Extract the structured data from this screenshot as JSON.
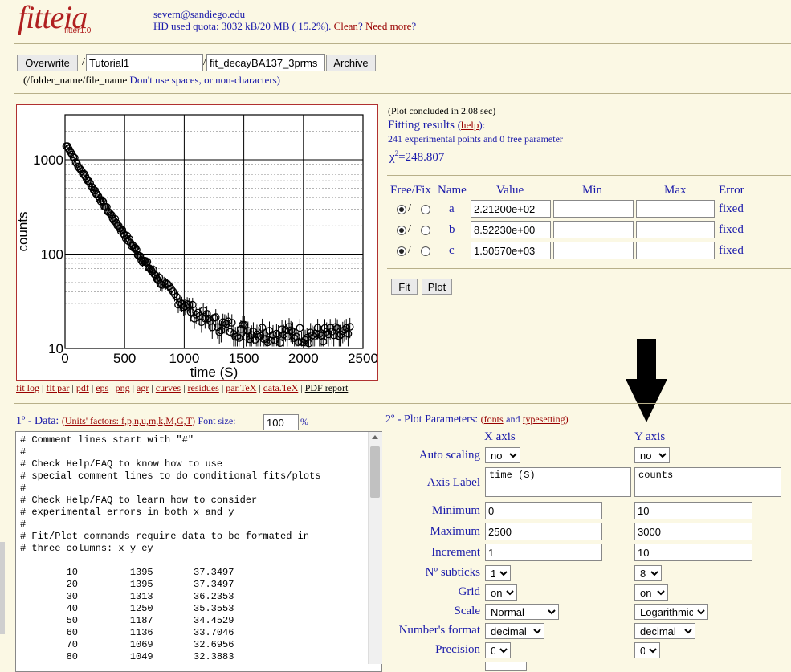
{
  "header": {
    "logo": "fitteia",
    "logo_sub": "fitter1.0",
    "email": "severn@sandiego.edu",
    "quota": "HD used quota: 3032 kB/20 MB ( 15.2%).",
    "clean": "Clean",
    "question": "?",
    "need_more": "Need more",
    "question2": "?"
  },
  "file": {
    "overwrite": "Overwrite",
    "slash1": "/",
    "folder": "Tutorial1",
    "slash2": "/",
    "filename": "fit_decayBA137_3prms",
    "archive": "Archive",
    "hint_path": "(/folder_name/file_name",
    "hint_text": "Don't use spaces, or non-characters)"
  },
  "plot": {
    "chart_data": {
      "type": "scatter",
      "xlabel": "time (S)",
      "ylabel": "counts",
      "xlim": [
        0,
        2500
      ],
      "ylim": [
        10,
        3000
      ],
      "yscale": "log",
      "grid": true,
      "x_ticks": [
        "0",
        "500",
        "1000",
        "1500",
        "2000",
        "2500"
      ],
      "y_ticks": [
        "10",
        "100",
        "1000"
      ],
      "model": {
        "a": 221.2,
        "b": 8.5223,
        "c": 1505.7
      },
      "points": [
        [
          10,
          1395
        ],
        [
          20,
          1395
        ],
        [
          30,
          1313
        ],
        [
          40,
          1250
        ],
        [
          50,
          1187
        ],
        [
          60,
          1136
        ],
        [
          70,
          1069
        ],
        [
          80,
          1049
        ]
      ]
    },
    "links": [
      "fit log",
      "fit par",
      "pdf",
      "eps",
      "png",
      "agr",
      "curves",
      "residues",
      "par.TeX",
      "data.TeX"
    ],
    "pdf_report": "PDF report"
  },
  "results": {
    "time": "(Plot concluded in 2.08 sec)",
    "title": "Fitting results",
    "help_open": "(",
    "help": "help",
    "help_close": "):",
    "summary": "241 experimental points and 0 free parameter",
    "chi_label": "χ",
    "chi_exp": "2",
    "chi_value": "=248.807",
    "headers": {
      "freefix": "Free/Fix",
      "name": "Name",
      "value": "Value",
      "min": "Min",
      "max": "Max",
      "error": "Error"
    },
    "params": [
      {
        "name": "a",
        "value": "2.21200e+02",
        "error": "fixed"
      },
      {
        "name": "b",
        "value": "8.52230e+00",
        "error": "fixed"
      },
      {
        "name": "c",
        "value": "1.50570e+03",
        "error": "fixed"
      }
    ],
    "slash": "/",
    "fit": "Fit",
    "plot": "Plot"
  },
  "data_panel": {
    "title": "1º - Data:",
    "units_open": "(",
    "units_link": "Units' factors: f,p,n,u,m,k,M,G,T",
    "units_close": ")",
    "font_size_label": "Font size:",
    "font_size": "100",
    "pct": "%",
    "content": "# Comment lines start with \"#\"\n#\n# Check Help/FAQ to know how to use\n# special comment lines to do conditional fits/plots\n#\n# Check Help/FAQ to learn how to consider\n# experimental errors in both x and y\n#\n# Fit/Plot commands require data to be formated in\n# three columns: x y ey\n\n        10         1395       37.3497\n        20         1395       37.3497\n        30         1313       36.2353\n        40         1250       35.3553\n        50         1187       34.4529\n        60         1136       33.7046\n        70         1069       32.6956\n        80         1049       32.3883"
  },
  "plot_params": {
    "title": "2º - Plot Parameters:",
    "open": "(",
    "fonts": "fonts",
    "and": "and",
    "typesetting": "typesetting",
    "close": ")",
    "x_header": "X axis",
    "y_header": "Y axis",
    "rows": {
      "auto_scaling": {
        "label": "Auto scaling",
        "x": "no",
        "y": "no"
      },
      "axis_label": {
        "label": "Axis Label",
        "x": "time (S)",
        "y": "counts"
      },
      "minimum": {
        "label": "Minimum",
        "x": "0",
        "y": "10"
      },
      "maximum": {
        "label": "Maximum",
        "x": "2500",
        "y": "3000"
      },
      "increment": {
        "label": "Increment",
        "x": "1",
        "y": "10"
      },
      "subticks": {
        "label": "Nº subticks",
        "x": "1",
        "y": "8"
      },
      "grid": {
        "label": "Grid",
        "x": "on",
        "y": "on"
      },
      "scale": {
        "label": "Scale",
        "x": "Normal",
        "y": "Logarithmic"
      },
      "numfmt": {
        "label": "Number's format",
        "x": "decimal",
        "y": "decimal"
      },
      "precision": {
        "label": "Precision",
        "x": "0",
        "y": "0"
      }
    }
  }
}
